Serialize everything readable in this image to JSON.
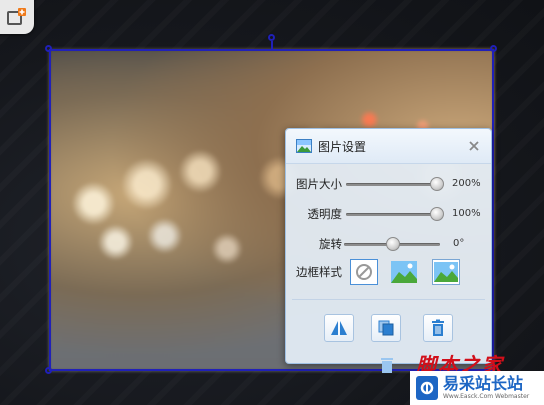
{
  "panel": {
    "title": "图片设置",
    "rows": {
      "size": {
        "label": "图片大小",
        "value_text": "200%",
        "value_fraction": 1.0
      },
      "opacity": {
        "label": "透明度",
        "value_text": "100%",
        "value_fraction": 1.0
      },
      "rotate": {
        "label": "旋转",
        "value_text": "0°",
        "value_fraction": 0.5
      }
    },
    "border_style_label": "边框样式",
    "border_styles": [
      "none-icon",
      "landscape-icon",
      "landscape-framed-icon"
    ],
    "actions": [
      "flip-horizontal-icon",
      "copy-icon",
      "delete-icon"
    ]
  },
  "watermark": {
    "brush_text": "脚本之家",
    "site_text": "易采站长站",
    "site_sub": "Www.Easck.Com  Webmaster"
  },
  "colors": {
    "selection": "#2020b8",
    "panel_bg": "#e4eef8",
    "accent": "#4a90d8",
    "watermark_red": "#d10f1a",
    "watermark_blue": "#1d66c4"
  }
}
